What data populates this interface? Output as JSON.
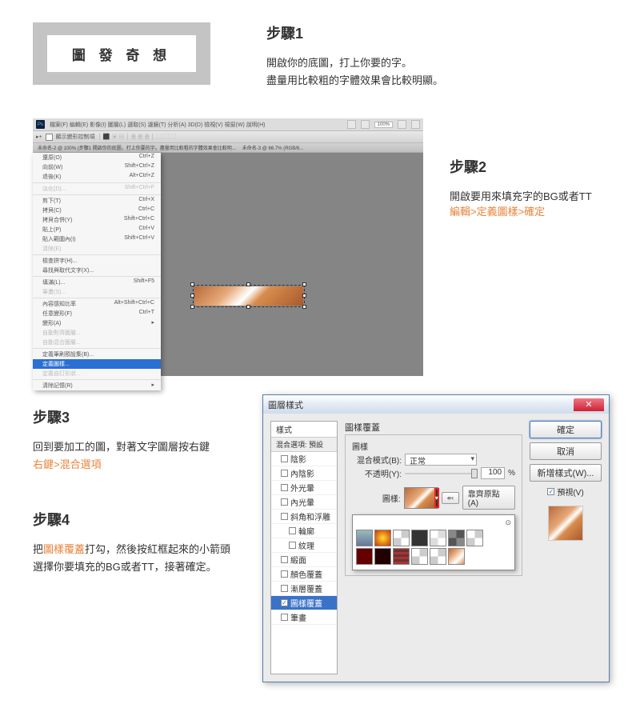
{
  "title_box": "圖 發 奇 想",
  "step1": {
    "title": "步驟1",
    "line1": "開啟你的底圖，打上你要的字。",
    "line2": "盡量用比較粗的字體效果會比較明顯。"
  },
  "ps1": {
    "menus": [
      "檔案(F)",
      "編輯(E)",
      "影像(I)",
      "圖層(L)",
      "選取(S)",
      "濾鏡(T)",
      "分析(A)",
      "3D(D)",
      "檢視(V)",
      "視窗(W)",
      "說明(H)"
    ],
    "zoom": "100%",
    "toolbar_hint": "顯示變形控制項",
    "tab_text": "未命名-2 @ 100% (步驟1 開啟你的底圖，打上你要的字。盡量用比較粗的字體效果會比較明...",
    "tab_text2": "未命名-3 @ 66.7% (RGB/8...",
    "dropdown": [
      {
        "l": "還原(O)",
        "r": "Ctrl+Z"
      },
      {
        "l": "向前(W)",
        "r": "Shift+Ctrl+Z"
      },
      {
        "l": "退後(K)",
        "r": "Alt+Ctrl+Z"
      },
      {
        "sep": true
      },
      {
        "l": "淡化(D)...",
        "r": "Shift+Ctrl+F",
        "dis": true
      },
      {
        "sep": true
      },
      {
        "l": "剪下(T)",
        "r": "Ctrl+X"
      },
      {
        "l": "拷貝(C)",
        "r": "Ctrl+C"
      },
      {
        "l": "拷貝合併(Y)",
        "r": "Shift+Ctrl+C"
      },
      {
        "l": "貼上(P)",
        "r": "Ctrl+V"
      },
      {
        "l": "貼入範圍內(I)",
        "r": "Shift+Ctrl+V"
      },
      {
        "l": "清除(E)",
        "r": "",
        "dis": true
      },
      {
        "sep": true
      },
      {
        "l": "檢查拼字(H)...",
        "r": ""
      },
      {
        "l": "尋找與取代文字(X)...",
        "r": ""
      },
      {
        "sep": true
      },
      {
        "l": "填滿(L)...",
        "r": "Shift+F5"
      },
      {
        "l": "筆畫(S)...",
        "r": "",
        "dis": true
      },
      {
        "sep": true
      },
      {
        "l": "內容感知比率",
        "r": "Alt+Shift+Ctrl+C"
      },
      {
        "l": "任意變形(F)",
        "r": "Ctrl+T"
      },
      {
        "l": "變形(A)",
        "r": "▸"
      },
      {
        "l": "自動對齊圖層...",
        "r": "",
        "dis": true
      },
      {
        "l": "自動混合圖層...",
        "r": "",
        "dis": true
      },
      {
        "sep": true
      },
      {
        "l": "定義筆刷預設集(B)...",
        "r": ""
      },
      {
        "l": "定義圖樣...",
        "r": "",
        "sel": true
      },
      {
        "l": "定義自訂形狀...",
        "r": "",
        "dis": true
      },
      {
        "sep": true
      },
      {
        "l": "清除記憶(R)",
        "r": "▸"
      }
    ]
  },
  "step2": {
    "title": "步驟2",
    "text": "開啟要用來填充字的BG或者TT",
    "path": "編輯>定義圖樣>確定"
  },
  "step3": {
    "title": "步驟3",
    "line1": "回到要加工的圖，對著文字圖層按右鍵",
    "path": "右鍵>混合選項"
  },
  "step4": {
    "title": "步驟4",
    "part1": "把",
    "hl": "圖樣覆蓋",
    "part2": "打勾，然後按紅框起來的小箭頭",
    "line2": "選擇你要填充的BG或者TT，接著確定。"
  },
  "dlg": {
    "title": "圖層樣式",
    "left_header": "樣式",
    "blend": "混合選項: 預設",
    "opts": [
      {
        "label": "陰影"
      },
      {
        "label": "內陰影"
      },
      {
        "label": "外光暈"
      },
      {
        "label": "內光暈"
      },
      {
        "label": "斜角和浮雕"
      },
      {
        "label": "輪廓",
        "sub": true
      },
      {
        "label": "紋理",
        "sub": true
      },
      {
        "label": "緞面"
      },
      {
        "label": "顏色覆蓋"
      },
      {
        "label": "漸層覆蓋"
      },
      {
        "label": "圖樣覆蓋",
        "sel": true,
        "checked": true
      },
      {
        "label": "筆畫"
      }
    ],
    "mid": {
      "group_title": "圖樣覆蓋",
      "sub_title": "圖樣",
      "blend_label": "混合模式(B):",
      "blend_value": "正常",
      "opacity_label": "不透明(Y):",
      "opacity_value": "100",
      "opacity_unit": "%",
      "pattern_label": "圖樣:",
      "snap_btn": "靠齊原點(A)"
    },
    "right": {
      "ok": "確定",
      "cancel": "取消",
      "new_style": "新增樣式(W)...",
      "preview": "預視(V)"
    }
  }
}
